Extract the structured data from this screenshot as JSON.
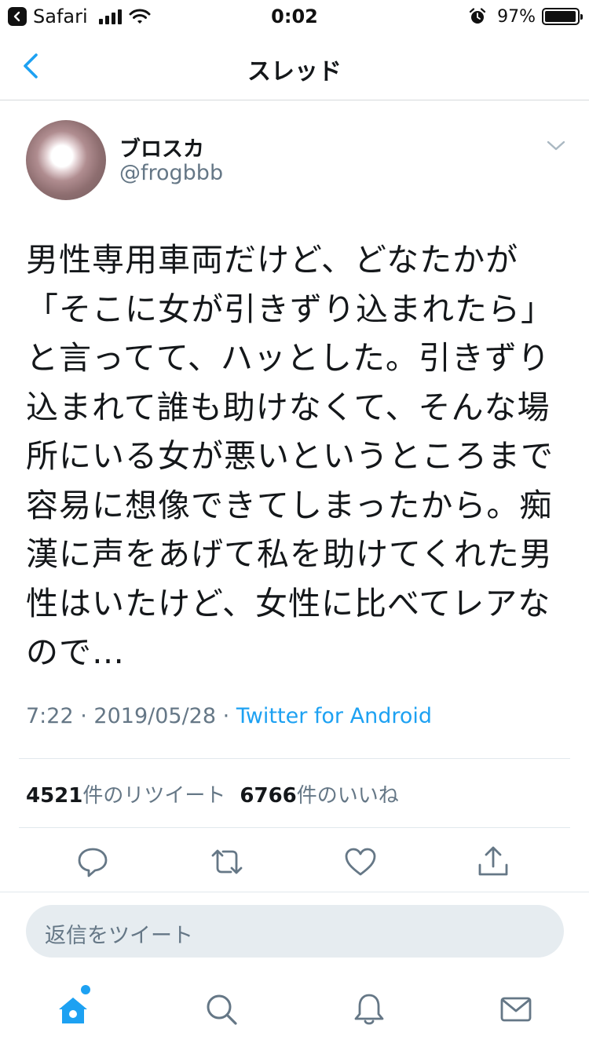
{
  "status_bar": {
    "app": "Safari",
    "time": "0:02",
    "battery_percent": "97%"
  },
  "nav": {
    "title": "スレッド"
  },
  "tweet": {
    "display_name": "ブロスカ",
    "handle": "@frogbbb",
    "text": "男性専用車両だけど、どなたかが「そこに女が引きずり込まれたら」と言ってて、ハッとした。引きずり込まれて誰も助けなくて、そんな場所にいる女が悪いというところまで容易に想像できてしまったから。痴漢に声をあげて私を助けてくれた男性はいたけど、女性に比べてレアなので…",
    "time": "7:22",
    "date": "2019/05/28",
    "separator": "·",
    "source": "Twitter for Android"
  },
  "stats": {
    "retweets": "4521",
    "retweets_label": "件のリツイート",
    "likes": "6766",
    "likes_label": "件のいいね"
  },
  "reply": {
    "placeholder": "返信をツイート"
  },
  "colors": {
    "accent": "#1da1f2",
    "secondary_text": "#657786",
    "reply_bg": "#e6ecf0"
  },
  "icons": {
    "actions": [
      "reply-icon",
      "retweet-icon",
      "like-icon",
      "share-icon"
    ],
    "tabs": [
      "home-icon",
      "search-icon",
      "notifications-icon",
      "messages-icon"
    ]
  }
}
